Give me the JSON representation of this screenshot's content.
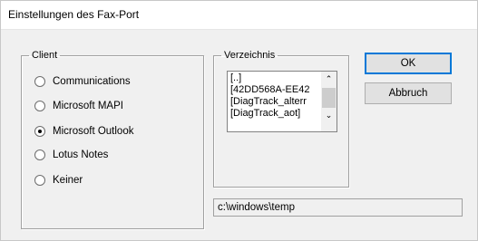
{
  "window": {
    "title": "Einstellungen des Fax-Port"
  },
  "client": {
    "legend": "Client",
    "options": [
      {
        "label": "Communications",
        "selected": false
      },
      {
        "label": "Microsoft MAPI",
        "selected": false
      },
      {
        "label": "Microsoft Outlook",
        "selected": true
      },
      {
        "label": "Lotus Notes",
        "selected": false
      },
      {
        "label": "Keiner",
        "selected": false
      }
    ]
  },
  "directory": {
    "legend": "Verzeichnis",
    "items": [
      "[..]",
      "[42DD568A-EE42",
      "[DiagTrack_alterr",
      "[DiagTrack_aot]"
    ]
  },
  "buttons": {
    "ok": "OK",
    "cancel": "Abbruch"
  },
  "path": {
    "value": "c:\\windows\\temp"
  },
  "icons": {
    "radio_unchecked": "radio-empty",
    "radio_checked": "radio-dot",
    "scroll_up": "chevron-up",
    "scroll_down": "chevron-down"
  }
}
